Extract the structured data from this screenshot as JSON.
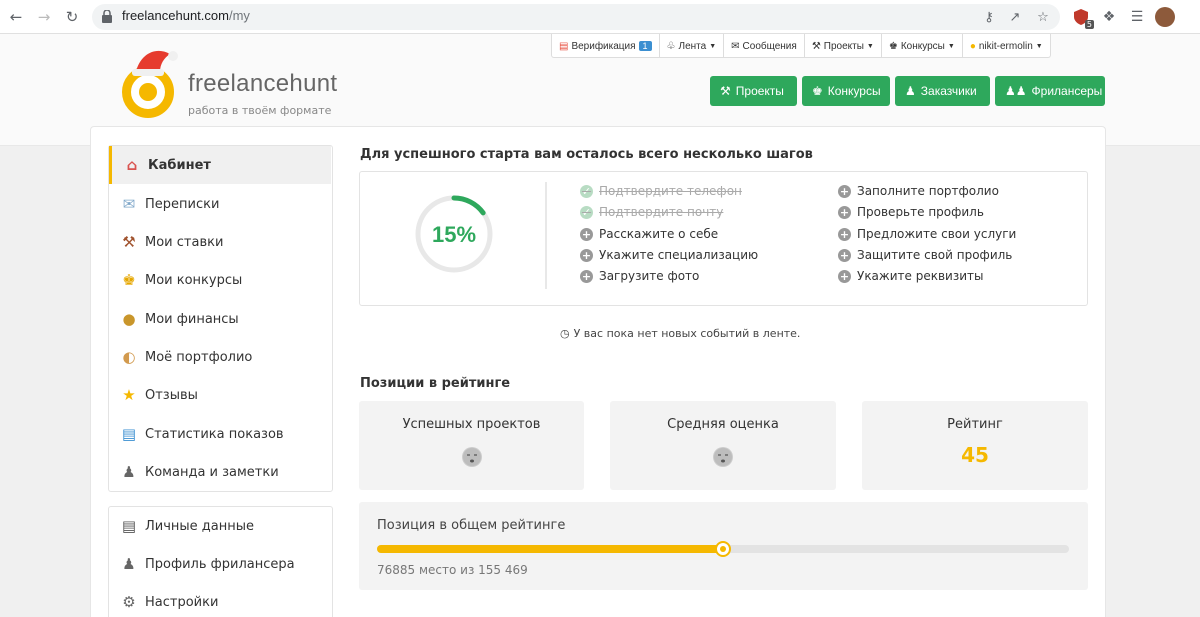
{
  "browser": {
    "url_host": "freelancehunt.com",
    "url_path": "/my",
    "extension_badge": "5"
  },
  "site": {
    "logo_name": "freelancehunt",
    "logo_tagline": "работа в твоём формате",
    "topbar": {
      "verification": "Верификация",
      "verification_count": "1",
      "feed": "Лента",
      "messages": "Сообщения",
      "projects": "Проекты",
      "contests": "Конкурсы",
      "user": "nikit-ermolin"
    },
    "nav_buttons": [
      "Проекты",
      "Конкурсы",
      "Заказчики",
      "Фрилансеры"
    ]
  },
  "sidebar": {
    "items": [
      {
        "label": "Кабинет",
        "icon": "house-icon"
      },
      {
        "label": "Переписки",
        "icon": "envelope-icon"
      },
      {
        "label": "Мои ставки",
        "icon": "gavel-icon"
      },
      {
        "label": "Мои конкурсы",
        "icon": "trophy-icon"
      },
      {
        "label": "Мои финансы",
        "icon": "money-bag-icon"
      },
      {
        "label": "Моё портфолио",
        "icon": "palette-icon"
      },
      {
        "label": "Отзывы",
        "icon": "star-icon"
      },
      {
        "label": "Статистика показов",
        "icon": "chart-icon"
      },
      {
        "label": "Команда и заметки",
        "icon": "team-icon"
      }
    ],
    "items2": [
      {
        "label": "Личные данные",
        "icon": "id-card-icon"
      },
      {
        "label": "Профиль фрилансера",
        "icon": "freelancer-icon"
      },
      {
        "label": "Настройки",
        "icon": "gear-icon"
      }
    ]
  },
  "steps": {
    "title": "Для успешного старта вам осталось всего несколько шагов",
    "progress_percent": 15,
    "progress_label": "15%",
    "left": [
      {
        "text": "Подтвердите телефон",
        "done": true
      },
      {
        "text": "Подтвердите почту",
        "done": true
      },
      {
        "text": "Расскажите о себе",
        "done": false
      },
      {
        "text": "Укажите специализацию",
        "done": false
      },
      {
        "text": "Загрузите фото",
        "done": false
      }
    ],
    "right": [
      {
        "text": "Заполните портфолио",
        "done": false
      },
      {
        "text": "Проверьте профиль",
        "done": false
      },
      {
        "text": "Предложите свои услуги",
        "done": false
      },
      {
        "text": "Защитите свой профиль",
        "done": false
      },
      {
        "text": "Укажите реквизиты",
        "done": false
      }
    ]
  },
  "feed_note": "У вас пока нет новых событий в ленте.",
  "rating": {
    "title": "Позиции в рейтинге",
    "cards": [
      {
        "label": "Успешных проектов",
        "value": ""
      },
      {
        "label": "Средняя оценка",
        "value": ""
      },
      {
        "label": "Рейтинг",
        "value": "45"
      }
    ],
    "overall_title": "Позиция в общем рейтинге",
    "overall_fraction": 0.5,
    "overall_text": "76885 место из 155 469"
  },
  "colors": {
    "accent": "#f5b800",
    "green": "#2ea85c"
  }
}
